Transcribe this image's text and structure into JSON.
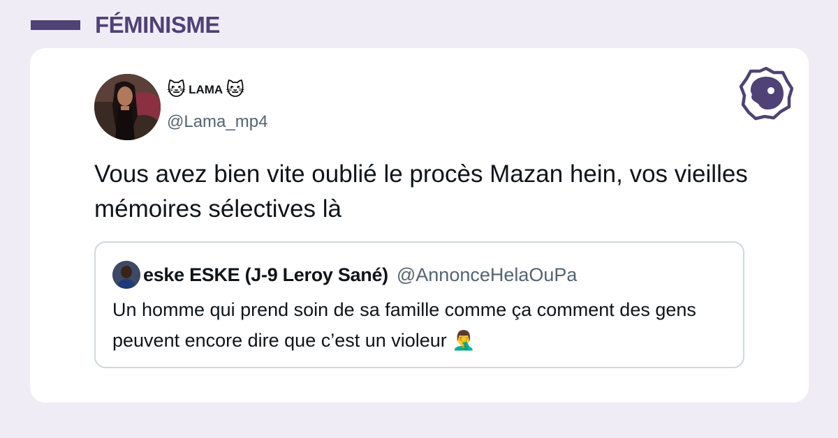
{
  "category": {
    "label": "FÉMINISME"
  },
  "tweet": {
    "author_emoji_left": "🐱",
    "author_name": "LAMA",
    "author_emoji_right": "🐱",
    "author_handle": "@Lama_mp4",
    "text": "Vous avez bien vite oublié le procès Mazan hein, vos vieilles mémoires sélectives là"
  },
  "quoted_tweet": {
    "author_name": "eske ESKE (J-9 Leroy Sané)",
    "author_handle": "@AnnonceHelaOuPa",
    "text": "Un homme qui prend soin de sa famille comme ça comment des gens peuvent encore dire que c’est un violeur 🤦‍♂️"
  },
  "colors": {
    "background": "#efecf6",
    "brand_purple": "#4e4276",
    "card": "#ffffff",
    "text_primary": "#0f1419",
    "text_secondary": "#536471",
    "quote_border": "#cfd9de"
  },
  "icons": {
    "brand_logo": "brand-logo-icon",
    "cat_emoji": "cat-face-icon"
  }
}
